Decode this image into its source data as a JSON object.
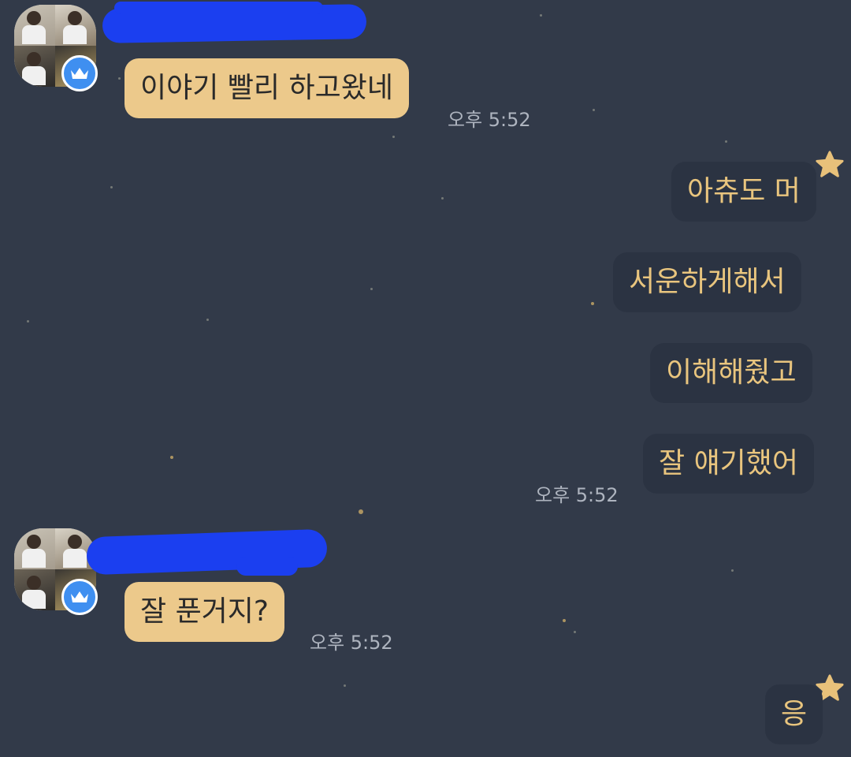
{
  "messages": [
    {
      "id": "m1",
      "direction": "incoming",
      "text": "이야기 빨리 하고왔네",
      "time": "오후 5:52"
    },
    {
      "id": "m2",
      "direction": "outgoing",
      "text": "아츄도 머"
    },
    {
      "id": "m3",
      "direction": "outgoing",
      "text": "서운하게해서"
    },
    {
      "id": "m4",
      "direction": "outgoing",
      "text": "이해해줬고"
    },
    {
      "id": "m5",
      "direction": "outgoing",
      "text": "잘 얘기했어",
      "time": "오후 5:52"
    },
    {
      "id": "m6",
      "direction": "incoming",
      "text": "잘 푼거지?",
      "time": "오후 5:52"
    },
    {
      "id": "m7",
      "direction": "outgoing",
      "text": "응"
    }
  ],
  "sender": {
    "avatar_icon": "profile-avatar",
    "badge_icon": "crown-icon"
  },
  "colors": {
    "background": "#323a49",
    "incoming_bubble": "#ecc98b",
    "outgoing_bubble": "#2b3342",
    "outgoing_text": "#e9c57e",
    "badge": "#3f8ff0",
    "redaction": "#1b3ff0"
  }
}
